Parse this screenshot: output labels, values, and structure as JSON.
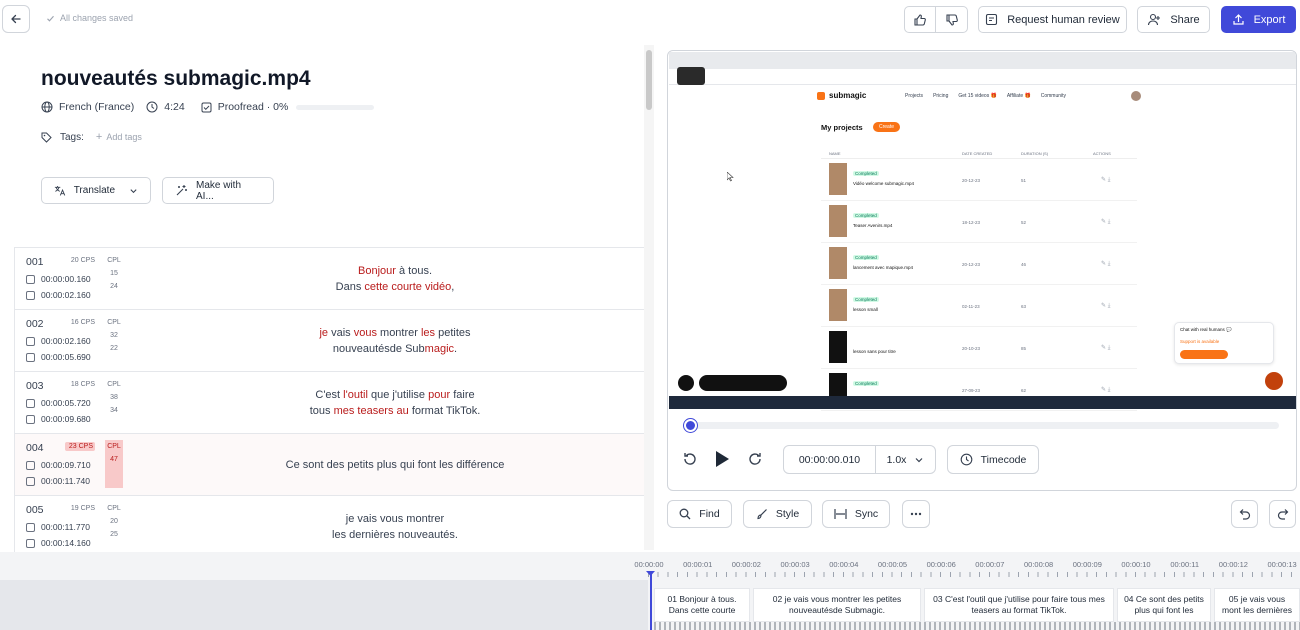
{
  "header": {
    "saved_status": "All changes saved",
    "request_review_label": "Request human review",
    "share_label": "Share",
    "export_label": "Export"
  },
  "project": {
    "title": "nouveautés submagic.mp4",
    "language": "French (France)",
    "duration": "4:24",
    "proofread": "Proofread · 0%",
    "proofread_progress": 0,
    "tags_label": "Tags:",
    "add_tags": "Add tags",
    "translate_label": "Translate",
    "make_with_ai_label": "Make with AI..."
  },
  "subtitles": [
    {
      "num": "001",
      "cps": "20 CPS",
      "start": "00:00:00.160",
      "end": "00:00:02.160",
      "cpl_label": "CPL",
      "cpl": [
        "15",
        "24"
      ],
      "line1": [
        [
          "Bonjour",
          true
        ],
        [
          " à tous.",
          false
        ]
      ],
      "line2": [
        [
          "Dans ",
          false
        ],
        [
          "cette courte vidéo",
          true
        ],
        [
          ",",
          false
        ]
      ],
      "warn": false
    },
    {
      "num": "002",
      "cps": "16 CPS",
      "start": "00:00:02.160",
      "end": "00:00:05.690",
      "cpl_label": "CPL",
      "cpl": [
        "32",
        "22"
      ],
      "line1": [
        [
          "je",
          true
        ],
        [
          " vais ",
          false
        ],
        [
          "vous",
          true
        ],
        [
          " montrer ",
          false
        ],
        [
          "les",
          true
        ],
        [
          " petites",
          false
        ]
      ],
      "line2": [
        [
          "nouveautésde Sub",
          false
        ],
        [
          "magic",
          true
        ],
        [
          ".",
          false
        ]
      ],
      "warn": false
    },
    {
      "num": "003",
      "cps": "18 CPS",
      "start": "00:00:05.720",
      "end": "00:00:09.680",
      "cpl_label": "CPL",
      "cpl": [
        "38",
        "34"
      ],
      "line1": [
        [
          "C'est ",
          false
        ],
        [
          "l'outil",
          true
        ],
        [
          " que j'utilise ",
          false
        ],
        [
          "pour",
          true
        ],
        [
          " faire",
          false
        ]
      ],
      "line2": [
        [
          "tous ",
          false
        ],
        [
          "mes teasers au",
          true
        ],
        [
          " format TikTok.",
          false
        ]
      ],
      "warn": false
    },
    {
      "num": "004",
      "cps": "23 CPS",
      "start": "00:00:09.710",
      "end": "00:00:11.740",
      "cpl_label": "CPL",
      "cpl": [
        "47"
      ],
      "line1": [
        [
          "Ce sont des petits plus qui font les différence",
          false
        ]
      ],
      "line2": [],
      "warn": true
    },
    {
      "num": "005",
      "cps": "19 CPS",
      "start": "00:00:11.770",
      "end": "00:00:14.160",
      "cpl_label": "CPL",
      "cpl": [
        "20",
        "25"
      ],
      "line1": [
        [
          "je vais vous montrer",
          false
        ]
      ],
      "line2": [
        [
          "les dernières nouveautés.",
          false
        ]
      ],
      "warn": false
    }
  ],
  "video_screen": {
    "app_name": "submagic",
    "nav": [
      "Projects",
      "Pricing",
      "Get 15 videos 🎁",
      "Affiliate 🎁",
      "Community"
    ],
    "heading": "My projects",
    "create": "Create",
    "chat_title": "Chat with real humans 💬",
    "chat_status": "Support is available",
    "columns": [
      "NAME",
      "DATE CREATED",
      "DURATION (S)",
      "ACTIONS"
    ],
    "rows": [
      {
        "badge": "Completed",
        "name": "Vidéo welcome submagic.mp4",
        "date": "20-12-23",
        "dur": "51"
      },
      {
        "badge": "Completed",
        "name": "Teaser Avenirs.mp4",
        "date": "18-12-23",
        "dur": "52"
      },
      {
        "badge": "Completed",
        "name": "lancement avec mapique.mp4",
        "date": "20-12-23",
        "dur": "46"
      },
      {
        "badge": "Completed",
        "name": "lesson small",
        "date": "02-11-23",
        "dur": "63"
      },
      {
        "badge": "",
        "name": "lesson sans pour titre",
        "date": "20-10-23",
        "dur": "85"
      },
      {
        "badge": "Completed",
        "name": "",
        "date": "27-09-23",
        "dur": "62"
      }
    ]
  },
  "player": {
    "time": "00:00:00.010",
    "speed": "1.0x",
    "timecode_label": "Timecode",
    "progress": 0
  },
  "tools": {
    "find": "Find",
    "style": "Style",
    "sync": "Sync"
  },
  "timeline": {
    "ticks": [
      "00:00:00",
      "00:00:01",
      "00:00:02",
      "00:00:03",
      "00:00:04",
      "00:00:05",
      "00:00:06",
      "00:00:07",
      "00:00:08",
      "00:00:09",
      "00:00:10",
      "00:00:11",
      "00:00:12",
      "00:00:13"
    ],
    "clips": [
      {
        "label": "01 Bonjour à tous. Dans cette courte"
      },
      {
        "label": "02 je vais vous montrer les petites nouveautésde Submagic."
      },
      {
        "label": "03 C'est l'outil que j'utilise pour faire tous mes teasers au format TikTok."
      },
      {
        "label": "04 Ce sont des petits plus qui font les"
      },
      {
        "label": "05 je vais vous mont les dernières"
      }
    ]
  },
  "colors": {
    "accent": "#4049d9",
    "warning": "#b91c1c",
    "warning_bg": "#f8c9c9"
  }
}
